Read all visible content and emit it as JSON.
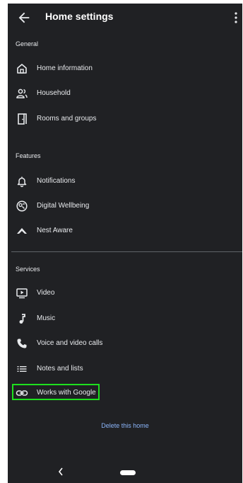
{
  "appbar": {
    "title": "Home settings"
  },
  "sections": {
    "general": {
      "header": "General",
      "items": [
        {
          "label": "Home information",
          "icon": "home-icon"
        },
        {
          "label": "Household",
          "icon": "household-icon"
        },
        {
          "label": "Rooms and groups",
          "icon": "door-icon"
        }
      ]
    },
    "features": {
      "header": "Features",
      "items": [
        {
          "label": "Notifications",
          "icon": "bell-icon"
        },
        {
          "label": "Digital Wellbeing",
          "icon": "wellbeing-icon"
        },
        {
          "label": "Nest Aware",
          "icon": "nest-aware-icon"
        }
      ]
    },
    "services": {
      "header": "Services",
      "items": [
        {
          "label": "Video",
          "icon": "video-icon"
        },
        {
          "label": "Music",
          "icon": "music-note-icon"
        },
        {
          "label": "Voice and video calls",
          "icon": "phone-icon"
        },
        {
          "label": "Notes and lists",
          "icon": "list-icon"
        },
        {
          "label": "Works with Google",
          "icon": "link-icon"
        }
      ]
    }
  },
  "delete_home_label": "Delete this home",
  "colors": {
    "background": "#202124",
    "text": "#e8eaed",
    "link": "#8ab4f8",
    "highlight": "#1ee01e"
  }
}
